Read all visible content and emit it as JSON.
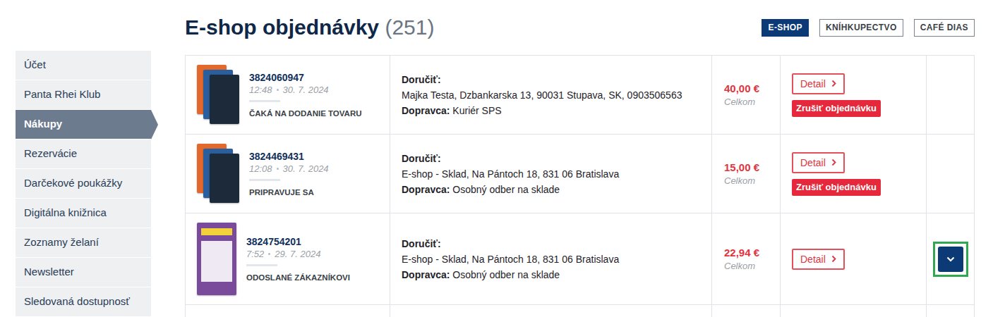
{
  "page": {
    "title": "E-shop objednávky",
    "count": "(251)"
  },
  "channels": [
    {
      "label": "E-SHOP",
      "selected": true
    },
    {
      "label": "KNÍHKUPECTVO",
      "selected": false
    },
    {
      "label": "CAFÉ DIAS",
      "selected": false
    }
  ],
  "sidebar": {
    "items": [
      {
        "label": "Účet",
        "selected": false
      },
      {
        "label": "Panta Rhei Klub",
        "selected": false
      },
      {
        "label": "Nákupy",
        "selected": true
      },
      {
        "label": "Rezervácie",
        "selected": false
      },
      {
        "label": "Darčekové poukážky",
        "selected": false
      },
      {
        "label": "Digitálna knižnica",
        "selected": false
      },
      {
        "label": "Zoznamy želaní",
        "selected": false
      },
      {
        "label": "Newsletter",
        "selected": false
      },
      {
        "label": "Sledovaná dostupnosť",
        "selected": false
      }
    ]
  },
  "orders": {
    "rows": [
      {
        "cover_kind": "stack",
        "number": "3824060947",
        "time": "12:48",
        "date": "30. 7. 2024",
        "status": "ČAKÁ NA DODANIE TOVARU",
        "deliver_label": "Doručiť:",
        "address": "Majka Testa, Dzbankarska 13, 90031 Stupava, SK, 0903506563",
        "carrier_label": "Dopravca:",
        "carrier": "Kuriér SPS",
        "price": "40,00 €",
        "price_label": "Celkom",
        "detail": "Detail",
        "cancel": "Zrušiť objednávku",
        "expandable": false,
        "highlighted": false
      },
      {
        "cover_kind": "stack",
        "number": "3824469431",
        "time": "12:08",
        "date": "30. 7. 2024",
        "status": "PRIPRAVUJE SA",
        "deliver_label": "Doručiť:",
        "address": "E-shop - Sklad, Na Pántoch 18, 831 06 Bratislava",
        "carrier_label": "Dopravca:",
        "carrier": "Osobný odber na sklade",
        "price": "15,00 €",
        "price_label": "Celkom",
        "detail": "Detail",
        "cancel": "Zrušiť objednávku",
        "expandable": false,
        "highlighted": false
      },
      {
        "cover_kind": "single",
        "number": "3824754201",
        "time": "7:52",
        "date": "29. 7. 2024",
        "status": "ODOSLANÉ ZÁKAZNÍKOVI",
        "deliver_label": "Doručiť:",
        "address": "E-shop - Sklad, Na Pántoch 18, 831 06 Bratislava",
        "carrier_label": "Dopravca:",
        "carrier": "Osobný odber na sklade",
        "price": "22,94 €",
        "price_label": "Celkom",
        "detail": "Detail",
        "expandable": true,
        "highlighted": true
      }
    ]
  }
}
